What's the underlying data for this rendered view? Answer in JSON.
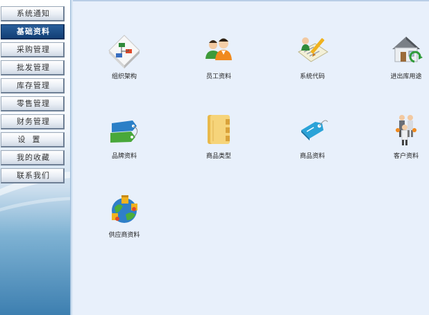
{
  "sidebar": {
    "items": [
      {
        "label": "系统通知",
        "active": false
      },
      {
        "label": "基础资料",
        "active": true
      },
      {
        "label": "采购管理",
        "active": false
      },
      {
        "label": "批发管理",
        "active": false
      },
      {
        "label": "库存管理",
        "active": false
      },
      {
        "label": "零售管理",
        "active": false
      },
      {
        "label": "财务管理",
        "active": false
      },
      {
        "label": "设置",
        "active": false
      },
      {
        "label": "我的收藏",
        "active": false
      },
      {
        "label": "联系我们",
        "active": false
      }
    ]
  },
  "main": {
    "tiles": [
      {
        "label": "组织架构",
        "icon": "org-chart-icon"
      },
      {
        "label": "员工资料",
        "icon": "employees-icon"
      },
      {
        "label": "系统代码",
        "icon": "system-code-icon"
      },
      {
        "label": "进出库用途",
        "icon": "warehouse-house-icon"
      },
      {
        "label": "品牌资料",
        "icon": "brand-tags-icon"
      },
      {
        "label": "商品类型",
        "icon": "folder-icon"
      },
      {
        "label": "商品资料",
        "icon": "price-tag-icon"
      },
      {
        "label": "客户资料",
        "icon": "customers-icon"
      },
      {
        "label": "供应商资料",
        "icon": "supplier-globe-icon"
      }
    ]
  }
}
